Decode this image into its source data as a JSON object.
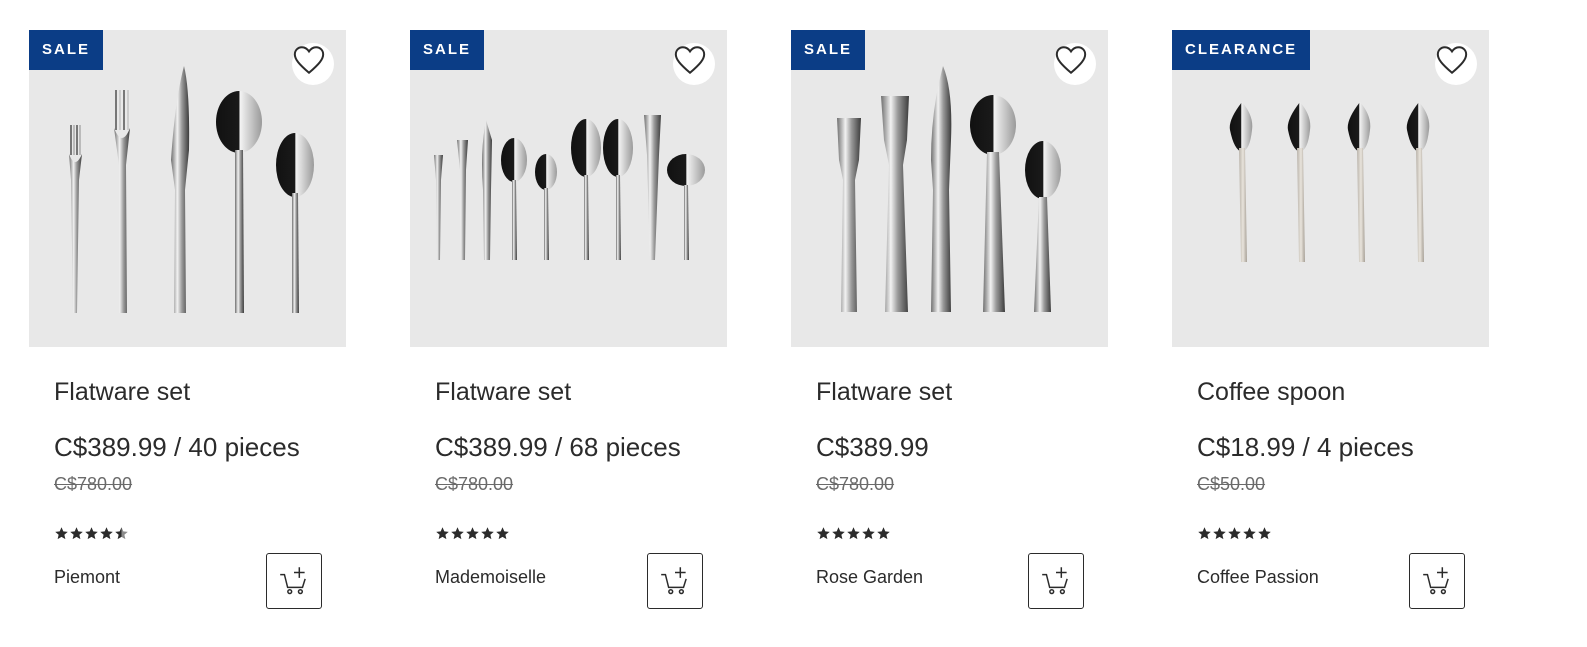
{
  "products": [
    {
      "badge": "SALE",
      "title": "Flatware set",
      "price": "C$389.99 / 40 pieces",
      "old_price": "C$780.00",
      "rating": 4.5,
      "brand": "Piemont",
      "image_icon": "flatware-set-image",
      "badge_color": "#0b3d86"
    },
    {
      "badge": "SALE",
      "title": "Flatware set",
      "price": "C$389.99 / 68 pieces",
      "old_price": "C$780.00",
      "rating": 5,
      "brand": "Mademoiselle",
      "image_icon": "flatware-set-image",
      "badge_color": "#0b3d86"
    },
    {
      "badge": "SALE",
      "title": "Flatware set",
      "price": "C$389.99",
      "old_price": "C$780.00",
      "rating": 5,
      "brand": "Rose Garden",
      "image_icon": "flatware-set-image",
      "badge_color": "#0b3d86"
    },
    {
      "badge": "CLEARANCE",
      "title": "Coffee spoon",
      "price": "C$18.99 / 4 pieces",
      "old_price": "C$50.00",
      "rating": 5,
      "brand": "Coffee Passion",
      "image_icon": "coffee-spoon-image",
      "badge_color": "#0b3d86"
    }
  ],
  "icons": {
    "wishlist": "heart-icon",
    "add_to_cart": "cart-plus-icon",
    "rating": "star-icon"
  }
}
